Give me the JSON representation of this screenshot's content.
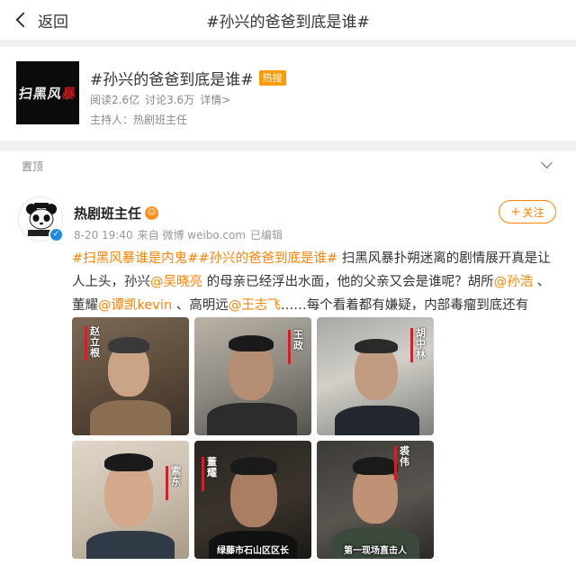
{
  "nav": {
    "back_label": "返回",
    "title": "#孙兴的爸爸到底是谁#"
  },
  "topic": {
    "cover_text_white": "扫黑风",
    "cover_text_red": "暴",
    "title": "#孙兴的爸爸到底是谁#",
    "hot_badge": "热搜",
    "reads": "阅读2.6亿",
    "discussions": "讨论3.6万",
    "details": "详情>",
    "host": "主持人：热剧班主任"
  },
  "pinned": {
    "label": "置顶"
  },
  "post": {
    "author": "热剧班主任",
    "meta": {
      "time": "8-20 19:40",
      "source": "来自 微博 weibo.com",
      "edited": "已编辑"
    },
    "follow_label": "关注",
    "follow_plus": "+",
    "text": {
      "tag1": "#扫黑风暴谁是内鬼#",
      "tag2": "#孙兴的爸爸到底是谁#",
      "part1": " 扫黑风暴扑朔迷离的剧情展开真是让人上头，孙兴",
      "mention1": "@吴晓亮",
      "part2": " 的母亲已经浮出水面，他的父亲又会是谁呢？胡所",
      "mention2": "@孙浩",
      "part3": " 、董耀",
      "mention3": "@谭凯kevin",
      "part4": " 、高明远",
      "mention4": "@王志飞",
      "part5": "……每个看着都有嫌疑，内部毒瘤到底还有呢？"
    },
    "photos": [
      {
        "name": "赵立根",
        "caption": ""
      },
      {
        "name": "王政",
        "caption": ""
      },
      {
        "name": "胡中林",
        "caption": ""
      },
      {
        "name": "索东",
        "caption": ""
      },
      {
        "name": "董耀",
        "caption": "绿藤市石山区区长"
      },
      {
        "name": "裘伟",
        "caption": "第一现场直击人"
      }
    ]
  },
  "colors": {
    "accent": "#ff8200",
    "hot_badge": "#ff9a00",
    "verified": "#1e88e5"
  }
}
